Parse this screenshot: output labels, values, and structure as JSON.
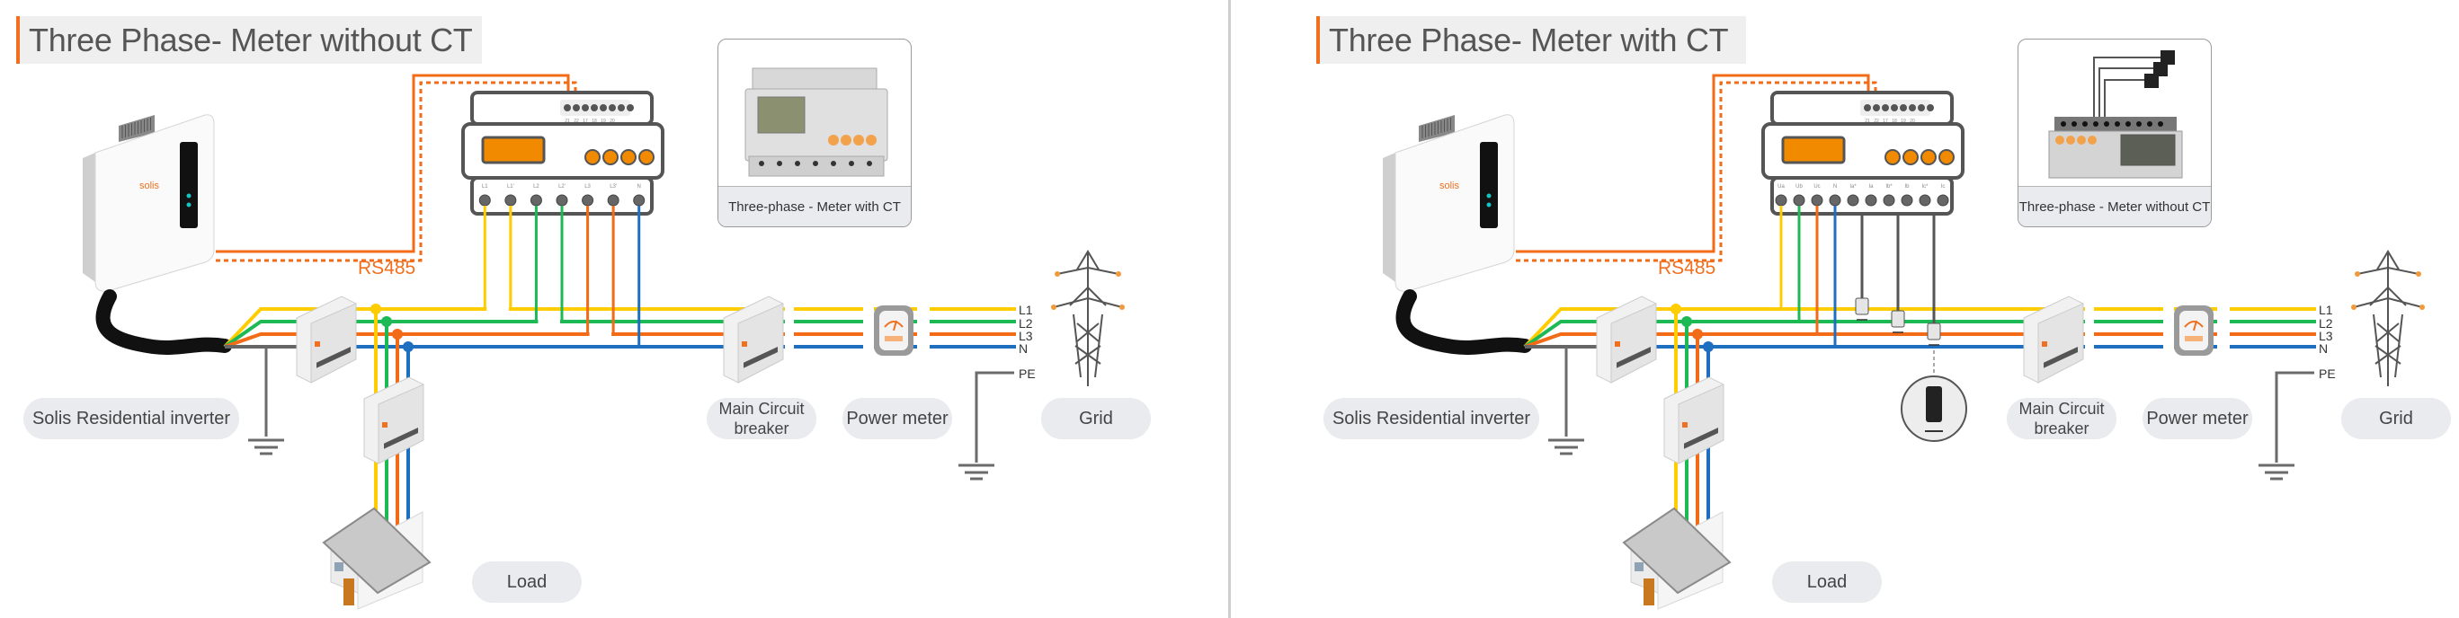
{
  "colors": {
    "accent": "#f07020",
    "L1": "#ffcc00",
    "L2": "#1db954",
    "L3": "#f36b16",
    "N": "#1f6fc0",
    "PE": "#6b6b6b",
    "meter_display": "#f28a00"
  },
  "panels": [
    {
      "title": "Three Phase- Meter without CT",
      "rs485_label": "RS485",
      "photo_caption": "Three-phase - Meter with CT",
      "meter_top_terminals": [
        "21",
        "22",
        "17",
        "18",
        "19",
        "20"
      ],
      "meter_top_sublabels": [
        "A",
        "B"
      ],
      "meter_bottom_terminals": [
        "L1",
        "L1'",
        "L2",
        "L2'",
        "L3",
        "L3'",
        "N"
      ],
      "line_labels": [
        "L1",
        "L2",
        "L3",
        "N",
        "PE"
      ],
      "labels": {
        "inverter": "Solis Residential inverter",
        "breaker": "Main Circuit breaker",
        "power_meter": "Power meter",
        "grid": "Grid",
        "load": "Load"
      }
    },
    {
      "title": "Three Phase- Meter with CT",
      "rs485_label": "RS485",
      "photo_caption": "Three-phase - Meter without CT",
      "meter_top_terminals": [
        "21",
        "22",
        "17",
        "18",
        "19",
        "20"
      ],
      "meter_top_sublabels": [
        "A",
        "B"
      ],
      "meter_bottom_terminals": [
        "Ua",
        "Ub",
        "Uc",
        "N",
        "Ia*",
        "Ia",
        "Ib*",
        "Ib",
        "Ic*",
        "Ic"
      ],
      "line_labels": [
        "L1",
        "L2",
        "L3",
        "N",
        "PE"
      ],
      "labels": {
        "inverter": "Solis Residential inverter",
        "breaker": "Main Circuit breaker",
        "power_meter": "Power meter",
        "grid": "Grid",
        "load": "Load"
      }
    }
  ]
}
